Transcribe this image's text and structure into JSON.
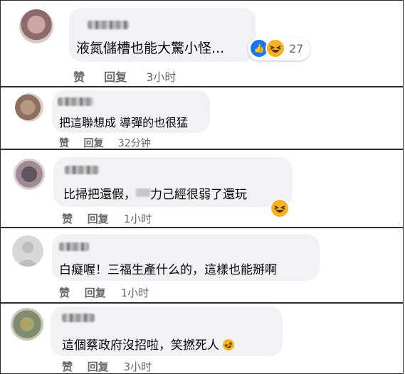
{
  "comments": [
    {
      "text": "液氮儲槽也能大驚小怪...",
      "actions": {
        "like": "赞",
        "reply": "回复",
        "time": "3小时"
      },
      "reaction_count": "27"
    },
    {
      "text": "把這聯想成 導彈的也很猛",
      "actions": {
        "like": "赞",
        "reply": "回复",
        "time": "32分钟"
      }
    },
    {
      "text_a": "比掃把還假，",
      "text_b": "力己經很弱了還玩",
      "actions": {
        "like": "赞",
        "reply": "回复",
        "time": "1小时"
      }
    },
    {
      "text": "白癡喔！三福生產什么的，這樣也能掰啊",
      "actions": {
        "like": "赞",
        "reply": "回复",
        "time": "1小时"
      }
    },
    {
      "text": "這個蔡政府沒招啦，笑撚死人",
      "actions": {
        "like": "赞",
        "reply": "回复",
        "time": "3小时"
      }
    }
  ],
  "icons": {
    "like": "like-icon",
    "laugh": "laughing-emoji-icon",
    "rofl": "rolling-laughing-emoji-icon"
  },
  "colors": {
    "accent": "#1877f2",
    "bubble": "#f0f2f5",
    "emoji": "#f7b125",
    "meta": "#65676b"
  }
}
